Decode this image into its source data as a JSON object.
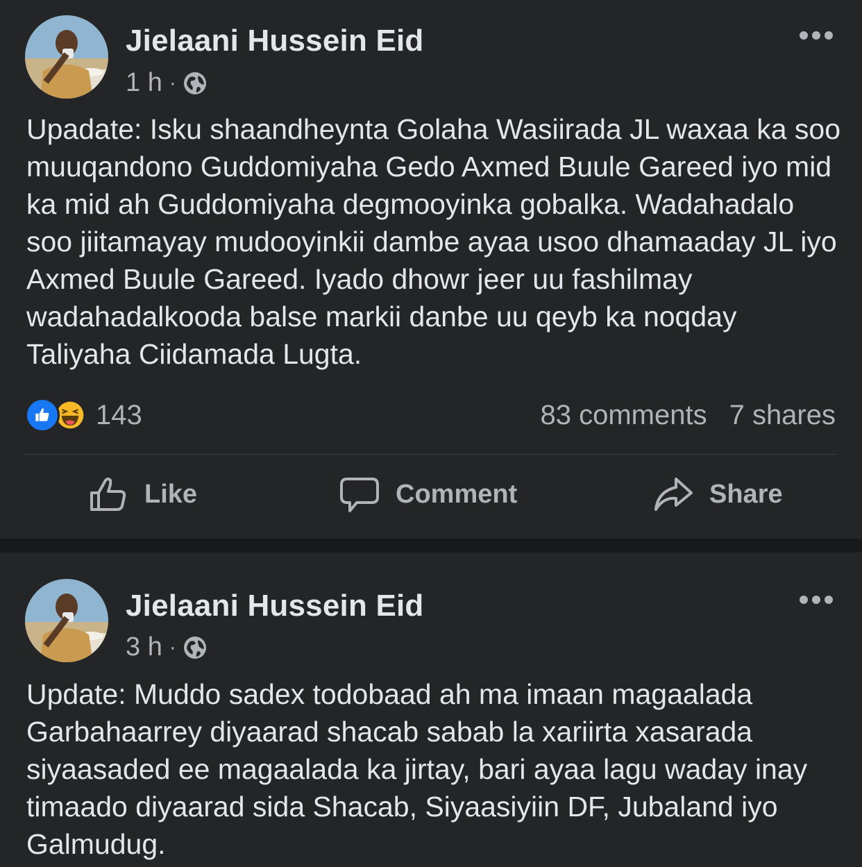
{
  "posts": [
    {
      "author": "Jielaani Hussein Eid",
      "time": "1 h",
      "separator": "·",
      "privacy_icon": "globe-icon",
      "text": "Upadate: Isku shaandheynta Golaha Wasiirada JL waxaa ka soo muuqandono Guddomiyaha Gedo Axmed Buule Gareed iyo mid ka mid ah Guddomiyaha degmooyinka gobalka. Wadahadalo soo jiitamayay mudooyinkii dambe ayaa usoo dhamaaday JL iyo Axmed Buule Gareed. Iyado dhowr jeer uu fashilmay wadahadalkooda balse markii danbe uu qeyb ka noqday Taliyaha Ciidamada Lugta.",
      "reaction_count": "143",
      "reactions": [
        "like",
        "haha"
      ],
      "comments": "83 comments",
      "shares": "7 shares",
      "actions": {
        "like": "Like",
        "comment": "Comment",
        "share": "Share"
      }
    },
    {
      "author": "Jielaani Hussein Eid",
      "time": "3 h",
      "separator": "·",
      "privacy_icon": "globe-icon",
      "text": "Update: Muddo sadex todobaad ah ma imaan magaalada Garbahaarrey diyaarad shacab sabab la xariirta xasarada siyaasaded ee magaalada ka jirtay, bari ayaa lagu waday inay timaado diyaarad sida Shacab, Siyaasiyiin DF, Jubaland iyo Galmudug."
    }
  ],
  "colors": {
    "background": "#18191a",
    "card": "#242526",
    "primary_text": "#e4e6eb",
    "secondary_text": "#b0b3b8",
    "like_blue": "#1877f2",
    "haha_yellow": "#f7b928"
  }
}
